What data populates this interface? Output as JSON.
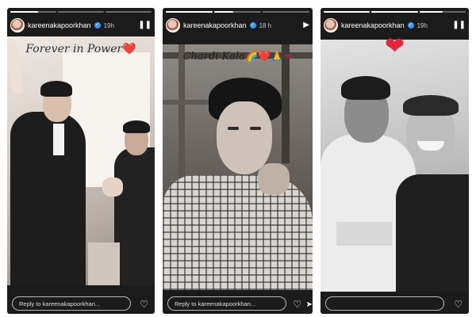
{
  "stories": [
    {
      "username": "kareenakapoorkhan",
      "time": "19h",
      "caption": "Forever in Power",
      "caption_emoji": "❤️",
      "reply_placeholder": "Reply to kareenakapoorkhan...",
      "progress": [
        0.6,
        0,
        0
      ],
      "state_icon": "pause-icon"
    },
    {
      "username": "kareenakapoorkhan",
      "time": "18 h",
      "caption": "Chardi Kala",
      "caption_emoji": "🌈❤️🙏∞",
      "reply_placeholder": "Reply to kareenakapoorkhan...",
      "progress": [
        1,
        0.4,
        0
      ],
      "state_icon": "play-icon"
    },
    {
      "username": "kareenakapoorkhan",
      "time": "19h",
      "caption": "",
      "caption_emoji": "❤",
      "reply_placeholder": "",
      "progress": [
        1,
        1,
        0.5
      ],
      "state_icon": "pause-icon"
    }
  ],
  "colors": {
    "story_bg": "#1b1b1b",
    "verified": "#3897f0",
    "heart": "#e3263c"
  }
}
